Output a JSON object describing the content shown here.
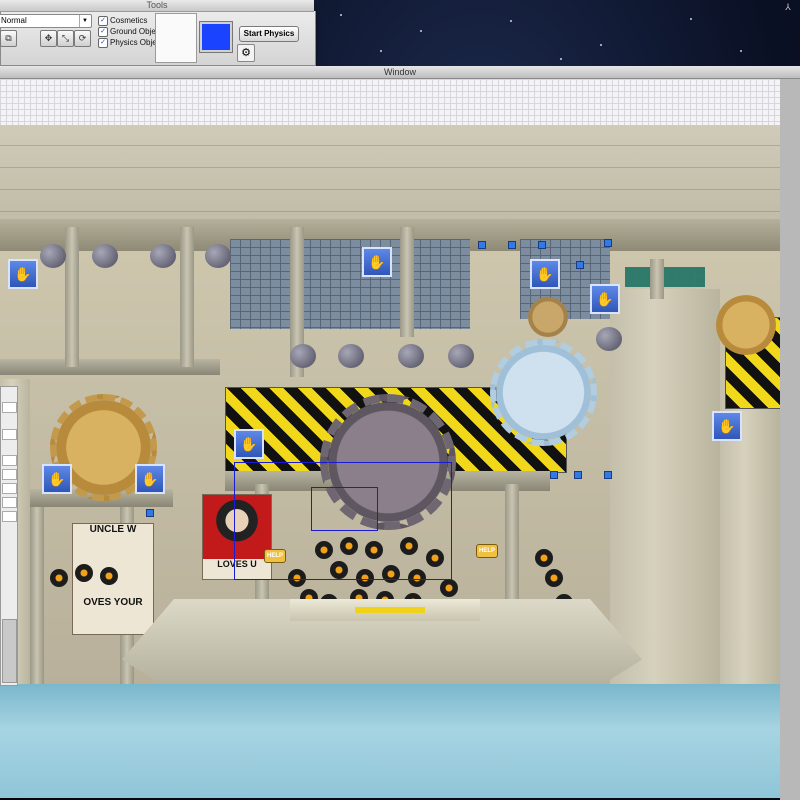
{
  "tools": {
    "title": "Tools",
    "mode_value": "Normal",
    "checkboxes": [
      {
        "label": "Cosmetics",
        "checked": true
      },
      {
        "label": "Ground Objects",
        "checked": true
      },
      {
        "label": "Physics Objects",
        "checked": true
      }
    ],
    "color_swatch": "#1a43ff",
    "start_button_label": "Start Physics"
  },
  "window": {
    "title": "Window"
  },
  "scene": {
    "poster_left_text_top": "UNCLE W",
    "poster_left_text_bottom": "OVES YOUR",
    "poster_center_text": "LOVES U",
    "help_sign_text": "HELP"
  }
}
